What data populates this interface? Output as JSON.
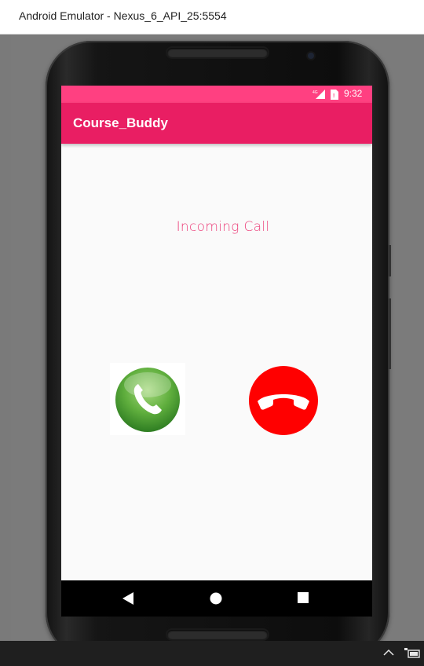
{
  "window": {
    "title": "Android Emulator - Nexus_6_API_25:5554"
  },
  "status_bar": {
    "network": "4G",
    "time": "9:32",
    "color": "#ff4081"
  },
  "app_bar": {
    "title": "Course_Buddy",
    "color": "#e91e63"
  },
  "call": {
    "label": "Incoming Call",
    "accept_icon": "phone-accept-icon",
    "decline_icon": "phone-decline-icon",
    "accept_color": "#5cab3c",
    "decline_color": "#ff0000"
  },
  "nav_bar": {
    "icons": [
      "back-icon",
      "home-icon",
      "recent-apps-icon"
    ]
  },
  "taskbar": {
    "icons": [
      "chevron-up-icon",
      "battery-icon"
    ]
  }
}
